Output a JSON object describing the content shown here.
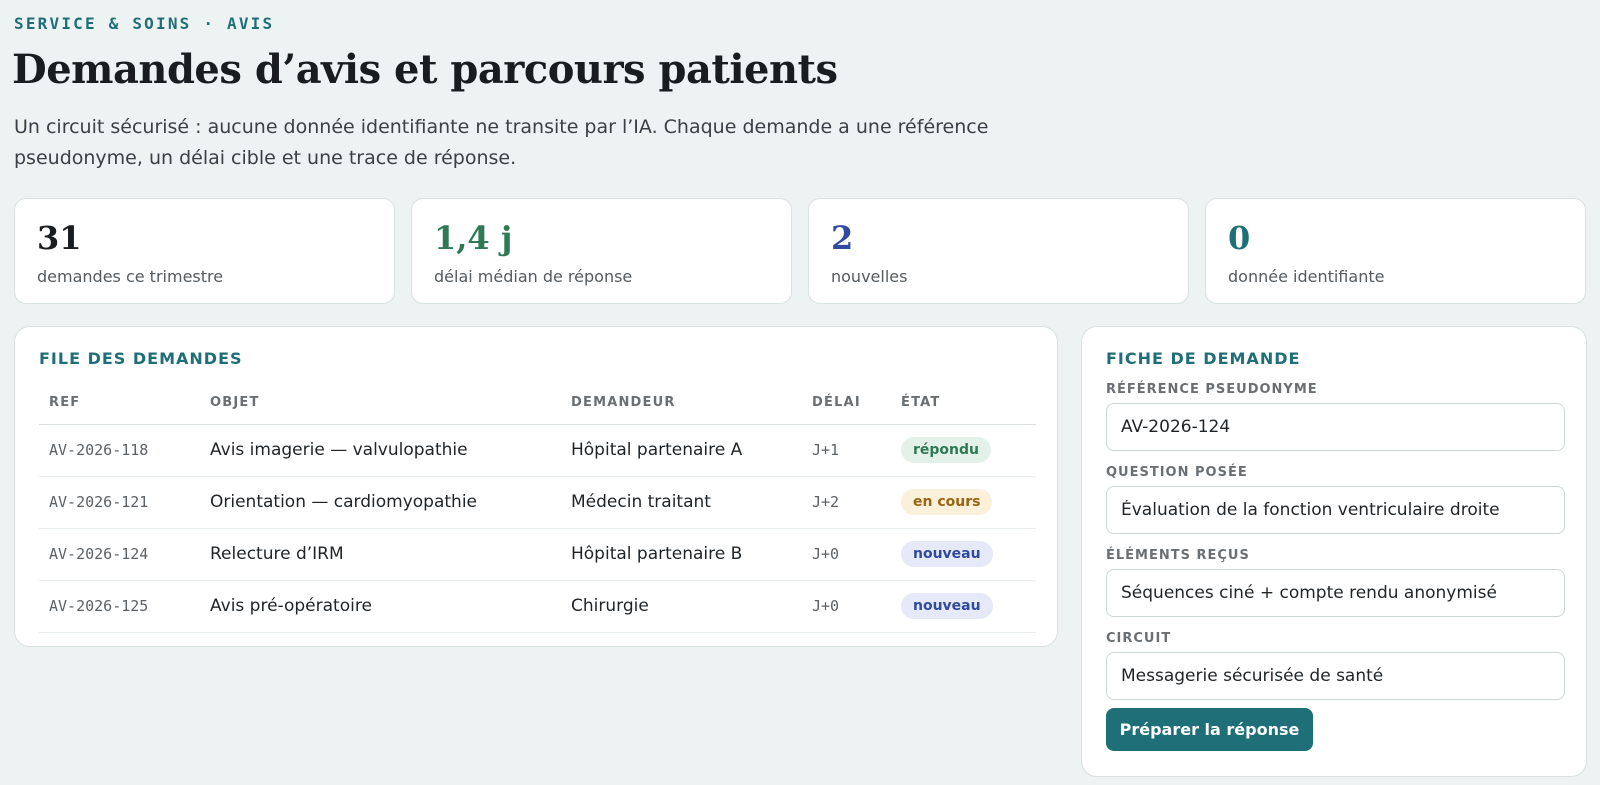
{
  "header": {
    "eyebrow": "SERVICE & SOINS · AVIS",
    "title": "Demandes d’avis et parcours patients",
    "lede": "Un circuit sécurisé : aucune donnée identifiante ne transite par l’IA. Chaque demande a une référence pseudonyme, un délai cible et une trace de réponse."
  },
  "stats": [
    {
      "value": "31",
      "label": "demandes ce trimestre",
      "color": "#1a1d20"
    },
    {
      "value": "1,4 j",
      "label": "délai médian de réponse",
      "color": "#2f7a55"
    },
    {
      "value": "2",
      "label": "nouvelles",
      "color": "#2f4a9e"
    },
    {
      "value": "0",
      "label": "donnée identifiante",
      "color": "#1f6f78"
    }
  ],
  "queue": {
    "title": "FILE DES DEMANDES",
    "columns": [
      "REF",
      "OBJET",
      "DEMANDEUR",
      "DÉLAI",
      "ÉTAT"
    ],
    "rows": [
      {
        "ref": "AV-2026-118",
        "objet": "Avis imagerie — valvulopathie",
        "demandeur": "Hôpital partenaire A",
        "delai": "J+1",
        "etat": "répondu"
      },
      {
        "ref": "AV-2026-121",
        "objet": "Orientation — cardiomyopathie",
        "demandeur": "Médecin traitant",
        "delai": "J+2",
        "etat": "en cours"
      },
      {
        "ref": "AV-2026-124",
        "objet": "Relecture d’IRM",
        "demandeur": "Hôpital partenaire B",
        "delai": "J+0",
        "etat": "nouveau"
      },
      {
        "ref": "AV-2026-125",
        "objet": "Avis pré-opératoire",
        "demandeur": "Chirurgie",
        "delai": "J+0",
        "etat": "nouveau"
      }
    ]
  },
  "status_colors": {
    "répondu": {
      "bg": "#e3f1e9",
      "fg": "#2f7a55"
    },
    "en cours": {
      "bg": "#fbf0d9",
      "fg": "#9a6414"
    },
    "nouveau": {
      "bg": "#e5e9f8",
      "fg": "#2f4a9e"
    }
  },
  "detail": {
    "title": "FICHE DE DEMANDE",
    "reference_label": "RÉFÉRENCE PSEUDONYME",
    "reference_value": "AV-2026-124",
    "question_label": "QUESTION POSÉE",
    "question_value": "Évaluation de la fonction ventriculaire droite",
    "elements_label": "ÉLÉMENTS REÇUS",
    "elements_value": "Séquences ciné + compte rendu anonymisé",
    "circuit_label": "CIRCUIT",
    "circuit_value": "Messagerie sécurisée de santé",
    "button_label": "Préparer la réponse"
  }
}
